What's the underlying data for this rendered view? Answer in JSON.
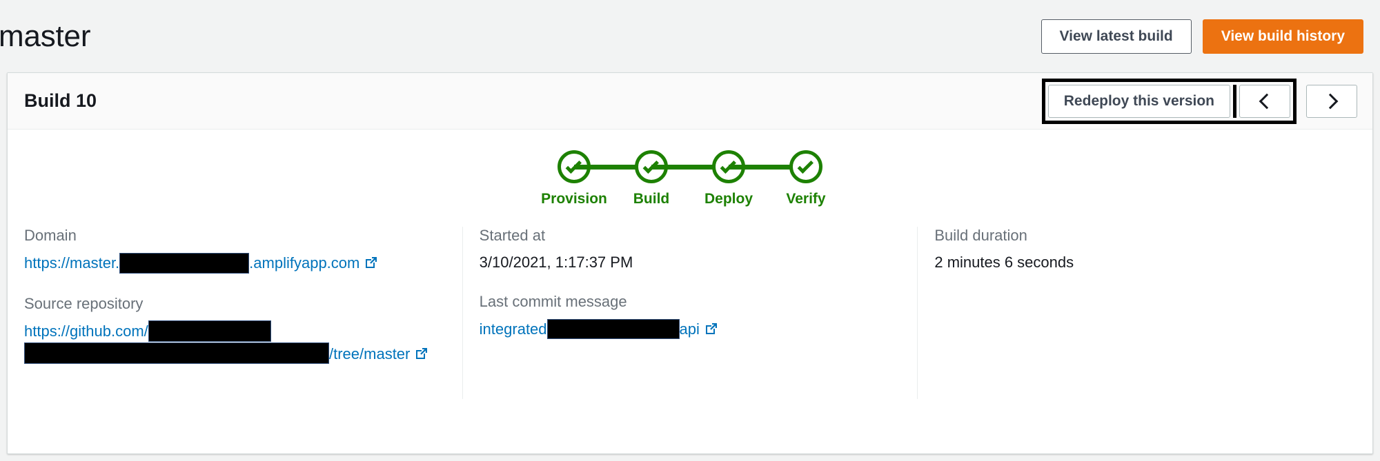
{
  "header": {
    "branch_title": "master",
    "view_latest_build_label": "View latest build",
    "view_build_history_label": "View build history"
  },
  "card": {
    "title": "Build 10",
    "redeploy_label": "Redeploy this version",
    "prev_label": "‹",
    "next_label": "›"
  },
  "pipeline": {
    "stages": [
      {
        "label": "Provision",
        "status": "success"
      },
      {
        "label": "Build",
        "status": "success"
      },
      {
        "label": "Deploy",
        "status": "success"
      },
      {
        "label": "Verify",
        "status": "success"
      }
    ]
  },
  "details": {
    "domain": {
      "label": "Domain",
      "link_prefix": "https://master.",
      "link_suffix": ".amplifyapp.com"
    },
    "source_repository": {
      "label": "Source repository",
      "link_prefix": "https://github.com/",
      "link_suffix": "/tree/master"
    },
    "started_at": {
      "label": "Started at",
      "value": "3/10/2021, 1:17:37 PM"
    },
    "last_commit_message": {
      "label": "Last commit message",
      "text_prefix": "integrated",
      "text_suffix": "api"
    },
    "build_duration": {
      "label": "Build duration",
      "value": "2 minutes 6 seconds"
    }
  },
  "colors": {
    "success_green": "#1d8102",
    "link_blue": "#0073bb",
    "primary_orange": "#ec7211",
    "page_bg": "#f2f3f3",
    "card_header_bg": "#fafafa"
  }
}
